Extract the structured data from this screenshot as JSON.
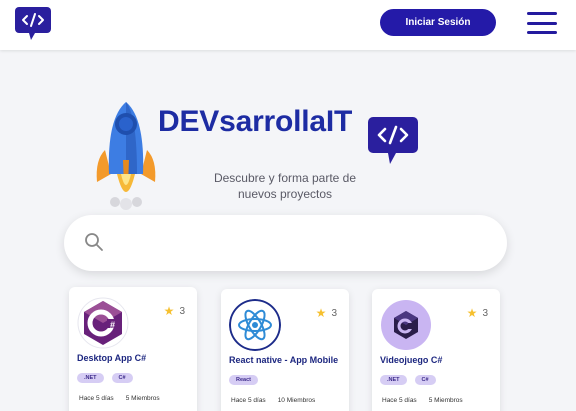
{
  "header": {
    "login_label": "Iniciar Sesión"
  },
  "hero": {
    "brand_part1": "DEV",
    "brand_part2": "sarrollaIT",
    "tagline_line1": "Descubre y forma parte de",
    "tagline_line2": "nuevos proyectos"
  },
  "search": {
    "placeholder": "",
    "value": ""
  },
  "projects": [
    {
      "title": "Desktop App C#",
      "stars": "3",
      "tags": [
        ".NET",
        "C#"
      ],
      "time": "Hace 5 días",
      "members": "5 Miembros",
      "icon": "csharp-icon"
    },
    {
      "title": "React native - App Mobile",
      "stars": "3",
      "tags": [
        "React"
      ],
      "time": "Hace 5 días",
      "members": "10 Miembros",
      "icon": "react-icon"
    },
    {
      "title": "Videojuego C#",
      "stars": "3",
      "tags": [
        ".NET",
        "C#"
      ],
      "time": "Hace 5 días",
      "members": "5 Miembros",
      "icon": "unity-icon"
    }
  ],
  "colors": {
    "primary": "#241aa8",
    "brand_blue": "#1d2ca3",
    "tag_bg": "#d6cdf4",
    "star": "#f6c02f"
  }
}
